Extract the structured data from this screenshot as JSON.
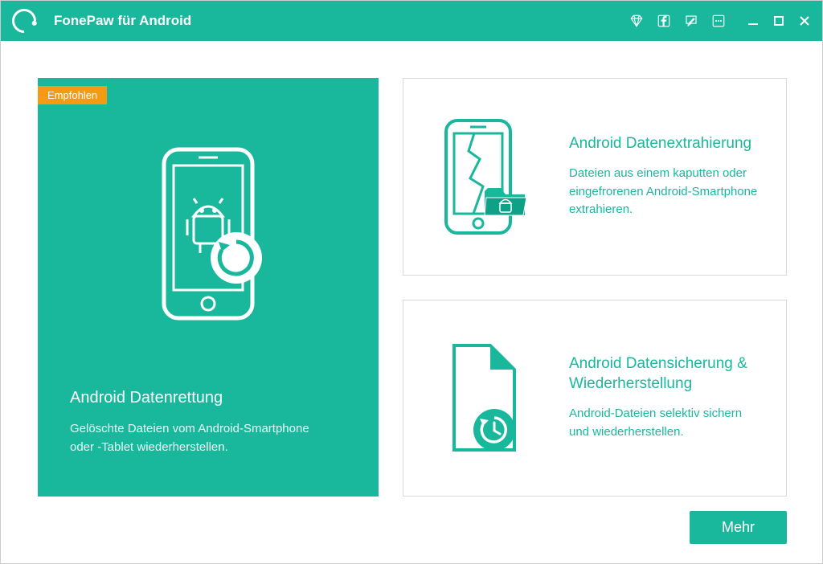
{
  "app": {
    "title": "FonePaw für Android"
  },
  "colors": {
    "accent": "#19b89d",
    "badge": "#f39c12"
  },
  "cards": {
    "featured": {
      "badge": "Empfohlen",
      "title": "Android Datenrettung",
      "desc": "Gelöschte Dateien vom Android-Smartphone oder -Tablet wiederherstellen."
    },
    "extract": {
      "title": "Android Datenextrahierung",
      "desc": "Dateien aus einem kaputten oder eingefrorenen Android-Smartphone extrahieren."
    },
    "backup": {
      "title": "Android Datensicherung & Wiederherstellung",
      "desc": "Android-Dateien selektiv sichern und wiederherstellen."
    }
  },
  "footer": {
    "more": "Mehr"
  }
}
